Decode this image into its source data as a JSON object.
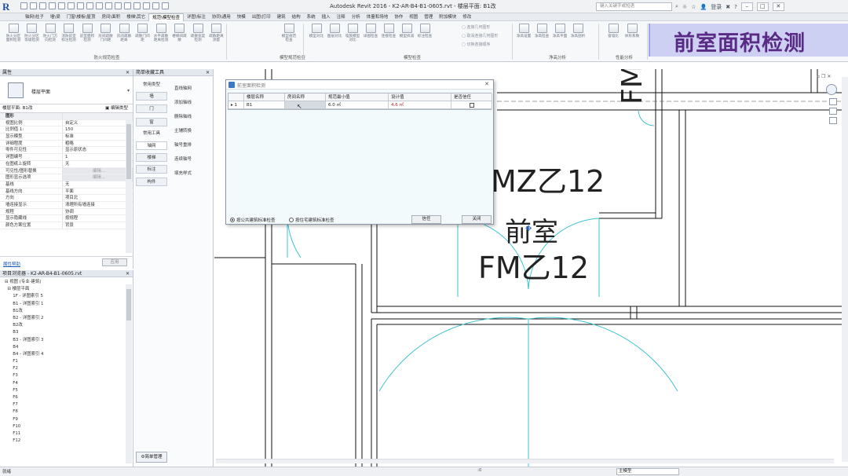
{
  "titlebar": {
    "title": "Autodesk Revit 2016 -    K2-AR-B4-B1-0605.rvt - 楼层平面: B1改",
    "search_placeholder": "键入关键字或短语",
    "user": "登录",
    "help": "?",
    "win_min": "–",
    "win_max": "□",
    "win_close": "✕"
  },
  "ribbon_tabs": [
    "轴网\\柱子",
    "墙\\梁",
    "门窗\\楼板\\屋顶",
    "房间\\面积",
    "楼梯\\其它",
    "规范\\模型检查",
    "详图\\标注",
    "协同\\通用",
    "快模",
    "出图\\打印",
    "建筑",
    "结构",
    "系统",
    "插入",
    "注释",
    "分析",
    "体量和场地",
    "协作",
    "视图",
    "管理",
    "附加模块",
    "修改"
  ],
  "ribbon_active_tab": "规范\\模型检查",
  "ribbon_buttons_fire": [
    "防火分区面积检测",
    "防火分区等级检测",
    "防火门方向检测",
    "消防前室标注检测",
    "前室面积检测",
    "房间疏散门间距",
    "房间疏散距离",
    "疏散门间距",
    "水平疏散距离检测",
    "楼梯间疏散",
    "疏散宽度检测",
    "疏散距离测量"
  ],
  "ribbon_buttons_model": [
    "模型规范检查",
    "模型对比",
    "图层对比",
    "墙族模型对比",
    "详图检查",
    "连接检查",
    "模型拆减",
    "标注检查"
  ],
  "ribbon_mini_items": [
    "连接几何图形",
    "取消连接几何图形",
    "切换连接顺序"
  ],
  "ribbon_buttons_net": [
    "净高设置",
    "净高检查",
    "净高平面",
    "净高剖析"
  ],
  "ribbon_buttons_perf": [
    "窗墙比",
    "体形系数"
  ],
  "ribbon_groups": {
    "fire": "防火规范检查",
    "rule": "模型规范检查",
    "model": "模型检查",
    "net": "净高分析",
    "perf": "性能分析"
  },
  "banner": "前室面积检测",
  "properties": {
    "title": "属性",
    "type_name": "楼层平面",
    "selector": "楼层平面: B1改",
    "edit_type": "编辑类型",
    "group_graphics": "图形",
    "rows": [
      {
        "k": "视图比例",
        "v": "自定义"
      },
      {
        "k": "比例值 1:",
        "v": "150"
      },
      {
        "k": "显示模型",
        "v": "标准"
      },
      {
        "k": "详细程度",
        "v": "粗略"
      },
      {
        "k": "零件可见性",
        "v": "显示原状态"
      },
      {
        "k": "可见性/图形替换",
        "v": "编辑..."
      },
      {
        "k": "图形显示选项",
        "v": "编辑..."
      },
      {
        "k": "基线",
        "v": "无"
      },
      {
        "k": "基线方向",
        "v": "平面"
      },
      {
        "k": "方向",
        "v": "项目北"
      },
      {
        "k": "墙连接显示",
        "v": "清理所有墙连接"
      },
      {
        "k": "规程",
        "v": "协调"
      },
      {
        "k": "显示隐藏线",
        "v": "按规程"
      },
      {
        "k": "颜色方案位置",
        "v": "背景"
      }
    ],
    "rows_pre": [
      {
        "k": "详图编号",
        "v": "1"
      },
      {
        "k": "在图纸上旋转",
        "v": "无"
      }
    ],
    "help": "属性帮助",
    "apply": "应用"
  },
  "browser": {
    "title": "项目浏览器 - K2-AR-B4-B1-0605.rvt",
    "items": [
      "⊟ 视图 (专业-建筑)",
      "  ⊟ 楼层平面",
      "      1F - 详图索引 5",
      "      B1 - 详图索引 1",
      "      B1改",
      "      B2 - 详图索引 2",
      "      B2改",
      "      B3",
      "      B3 - 详图索引 3",
      "      B4",
      "      B4 - 详图索引 4",
      "      F1",
      "      F2",
      "      F3",
      "      F4",
      "      F5",
      "      F6",
      "      F7",
      "      F8",
      "      F9",
      "      F10",
      "      F11",
      "      F12"
    ]
  },
  "tool_panel": {
    "title": "简单收藏工具",
    "cats": [
      "常用类型",
      "墙",
      "门",
      "窗",
      "常用工具",
      "轴网",
      "楼梯",
      "标注",
      "构件"
    ],
    "items": [
      "直线轴网",
      "添加轴线",
      "删除轴线",
      "主辅转换",
      "轴号重排",
      "连续轴号",
      "填充样式"
    ],
    "manage": "⚙简单管理"
  },
  "dialog": {
    "title": "前室面积检测",
    "headers": [
      "楼层名称",
      "房间名称",
      "规范最小值",
      "设计值",
      "是否信任"
    ],
    "row": {
      "index": "1",
      "floor": "B1",
      "room": "",
      "min": "6.0 ㎡",
      "design": "4.6 ㎡"
    },
    "radio1": "按公共建筑标准检查",
    "radio2": "按住宅建筑标准检查",
    "trust_btn": "信任",
    "close_btn": "关闭"
  },
  "drawing": {
    "label_top": "FM",
    "label_mid": "MZ乙12",
    "label_room": "前室",
    "label_bottom": "FM乙12"
  },
  "status": {
    "text": "就绪",
    "scale": ":0",
    "model": "主模型"
  },
  "colors": {
    "banner_bg": "#cdd0f3",
    "banner_text": "#5a2b86",
    "door_lines": "#3cc3d0",
    "value_red": "#c0202a"
  }
}
